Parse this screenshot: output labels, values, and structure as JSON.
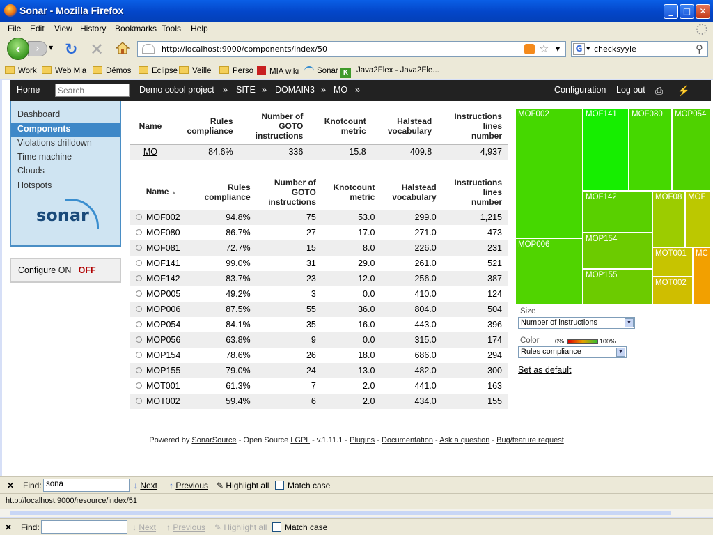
{
  "window": {
    "title": "Sonar - Mozilla Firefox",
    "minimize": "_",
    "maximize": "□",
    "close": "✕",
    "app_icon": "firefox-icon"
  },
  "menu": [
    "File",
    "Edit",
    "View",
    "History",
    "Bookmarks",
    "Tools",
    "Help"
  ],
  "nav": {
    "url": "http://localhost:9000/components/index/50",
    "search_value": "checksyyle",
    "search_engine": "G"
  },
  "bookmarks": [
    {
      "label": "Work",
      "icon": "folder-icon"
    },
    {
      "label": "Web Mia",
      "icon": "folder-icon"
    },
    {
      "label": "Démos",
      "icon": "folder-icon"
    },
    {
      "label": "Eclipse",
      "icon": "folder-icon"
    },
    {
      "label": "Veille",
      "icon": "folder-icon"
    },
    {
      "label": "Perso",
      "icon": "folder-icon"
    },
    {
      "label": "MIA wiki",
      "icon": "wiki-icon"
    },
    {
      "label": "Sonar",
      "icon": "sonar-icon"
    },
    {
      "label": "Java2Flex - Java2Fle...",
      "icon": "k-icon"
    }
  ],
  "sonar_nav": {
    "home": "Home",
    "search_placeholder": "Search",
    "crumbs": [
      "Demo cobol project",
      "»",
      "SITE",
      "»",
      "DOMAIN3",
      "»",
      "MO",
      "»"
    ],
    "configuration": "Configuration",
    "logout": "Log out"
  },
  "sidebar": {
    "items": [
      "Dashboard",
      "Components",
      "Violations drilldown",
      "Time machine",
      "Clouds",
      "Hotspots"
    ],
    "active": "Components",
    "logo": "sonar"
  },
  "configure": {
    "label": "Configure",
    "on": "ON",
    "sep": "|",
    "off": "OFF"
  },
  "table_headers": [
    "Name",
    "Rules\ncompliance",
    "Number of\nGOTO\ninstructions",
    "Knotcount\nmetric",
    "Halstead\nvocabulary",
    "Instructions\nlines\nnumber"
  ],
  "summary_row": [
    "MO",
    "84.6%",
    "336",
    "15.8",
    "409.8",
    "4,937"
  ],
  "sort_indicator": "▲",
  "rows": [
    [
      "MOF002",
      "94.8%",
      "75",
      "53.0",
      "299.0",
      "1,215"
    ],
    [
      "MOF080",
      "86.7%",
      "27",
      "17.0",
      "271.0",
      "473"
    ],
    [
      "MOF081",
      "72.7%",
      "15",
      "8.0",
      "226.0",
      "231"
    ],
    [
      "MOF141",
      "99.0%",
      "31",
      "29.0",
      "261.0",
      "521"
    ],
    [
      "MOF142",
      "83.7%",
      "23",
      "12.0",
      "256.0",
      "387"
    ],
    [
      "MOP005",
      "49.2%",
      "3",
      "0.0",
      "410.0",
      "124"
    ],
    [
      "MOP006",
      "87.5%",
      "55",
      "36.0",
      "804.0",
      "504"
    ],
    [
      "MOP054",
      "84.1%",
      "35",
      "16.0",
      "443.0",
      "396"
    ],
    [
      "MOP056",
      "63.8%",
      "9",
      "0.0",
      "315.0",
      "174"
    ],
    [
      "MOP154",
      "78.6%",
      "26",
      "18.0",
      "686.0",
      "294"
    ],
    [
      "MOP155",
      "79.0%",
      "24",
      "13.0",
      "482.0",
      "300"
    ],
    [
      "MOT001",
      "61.3%",
      "7",
      "2.0",
      "441.0",
      "163"
    ],
    [
      "MOT002",
      "59.4%",
      "6",
      "2.0",
      "434.0",
      "155"
    ]
  ],
  "treemap": {
    "tiles": [
      {
        "label": "MOF002",
        "color": "#45d800"
      },
      {
        "label": "MOP006",
        "color": "#50d400"
      },
      {
        "label": "MOF141",
        "color": "#16ee00"
      },
      {
        "label": "MOF080",
        "color": "#45d800"
      },
      {
        "label": "MOP054",
        "color": "#4fd200"
      },
      {
        "label": "MOF142",
        "color": "#59d000"
      },
      {
        "label": "MOP154",
        "color": "#6ccb00"
      },
      {
        "label": "MOP155",
        "color": "#6ccb00"
      },
      {
        "label": "MOF08",
        "color": "#9ccc00"
      },
      {
        "label": "MOF",
        "color": "#bcc800"
      },
      {
        "label": "MOT001",
        "color": "#c7c400"
      },
      {
        "label": "MOT002",
        "color": "#cfbe00"
      },
      {
        "label": "MC",
        "color": "#f2a000"
      }
    ],
    "size_label": "Size",
    "size_value": "Number of instructions",
    "color_label": "Color",
    "color_min": "0%",
    "color_max": "100%",
    "color_value": "Rules compliance",
    "set_default": "Set as default"
  },
  "footer": {
    "powered": "Powered by",
    "sonarsource": "SonarSource",
    "open_source": "- Open Source",
    "lgpl": "LGPL",
    "version": "- v.1.11.1 -",
    "plugins": "Plugins",
    "documentation": "Documentation",
    "ask": "Ask a question",
    "bug": "Bug/feature request",
    "dash": "-"
  },
  "findbar": {
    "label": "Find:",
    "value": "sona",
    "next": "Next",
    "previous": "Previous",
    "highlight": "Highlight all",
    "match_case": "Match case"
  },
  "status_url": "http://localhost:9000/resource/index/51",
  "findbar2": {
    "label": "Find:",
    "value": "",
    "next": "Next",
    "previous": "Previous",
    "highlight": "Highlight all",
    "match_case": "Match case"
  }
}
